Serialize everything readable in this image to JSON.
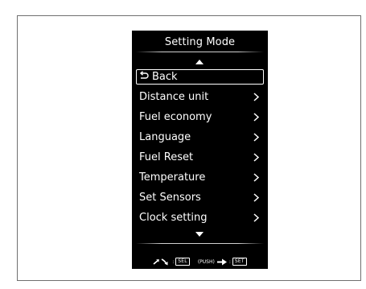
{
  "screen": {
    "title": "Setting Mode",
    "back_label": "Back",
    "menu_items": [
      {
        "label": "Distance unit"
      },
      {
        "label": "Fuel economy"
      },
      {
        "label": "Language"
      },
      {
        "label": "Fuel Reset"
      },
      {
        "label": "Temperature"
      },
      {
        "label": "Set Sensors"
      },
      {
        "label": "Clock setting"
      }
    ],
    "footer": {
      "select_key": "SEL",
      "push_label": "(PUSH)",
      "set_key": "SET",
      "colon": ":"
    }
  },
  "icons": {
    "scroll_up": "triangle-up-icon",
    "scroll_down": "triangle-down-icon",
    "back": "return-arrow-icon",
    "chevron": "chevron-right-icon",
    "turn": "rotate-arrows-icon",
    "push": "right-arrow-icon"
  },
  "colors": {
    "screen_bg": "#000000",
    "screen_text": "#ffffff",
    "frame_border": "#6f6f6f"
  }
}
